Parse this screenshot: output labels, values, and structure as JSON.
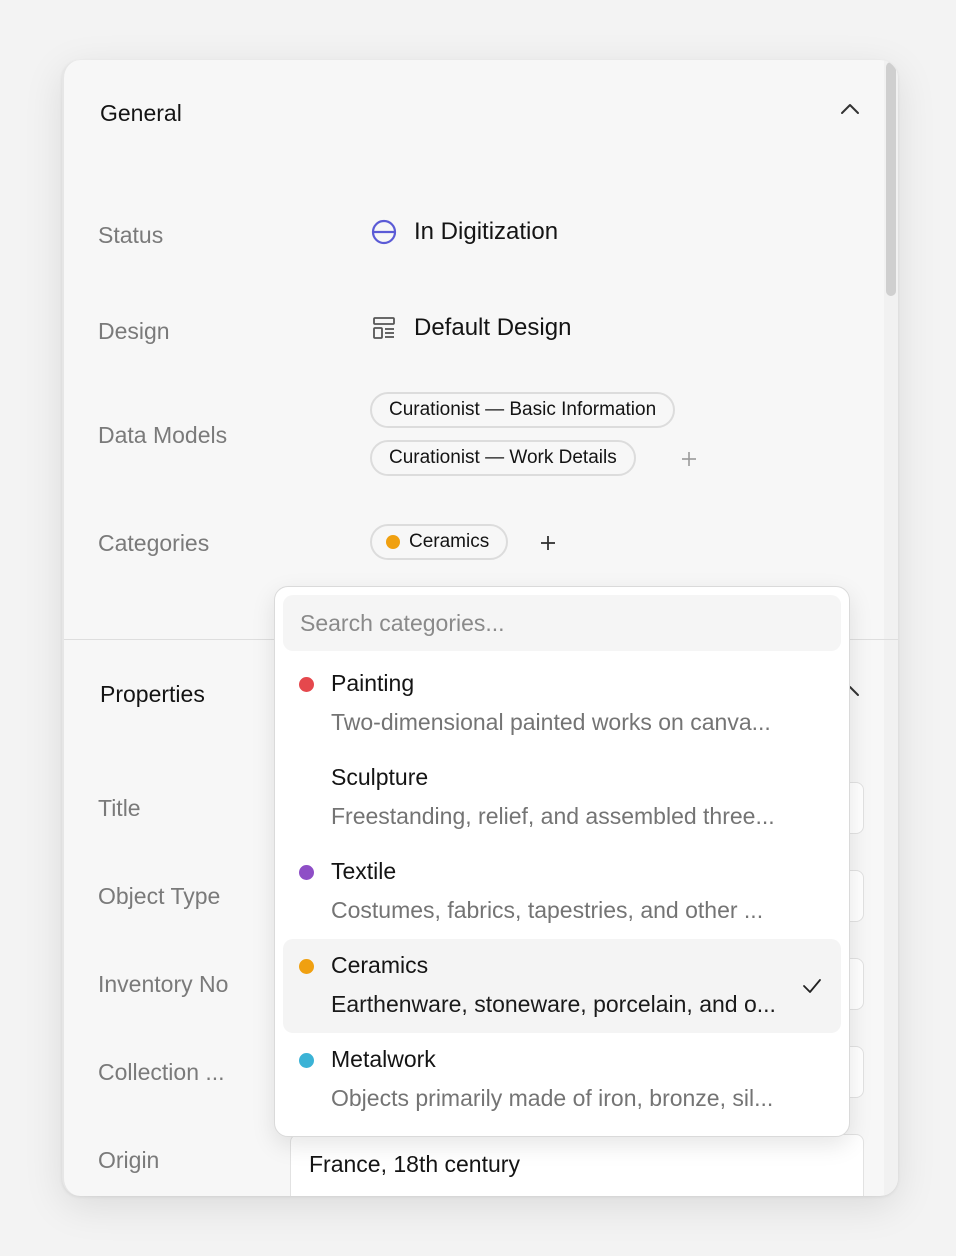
{
  "general": {
    "title": "General",
    "status": {
      "label": "Status",
      "value": "In Digitization",
      "icon": "half-circle-icon",
      "color": "#5b5bd6"
    },
    "design": {
      "label": "Design",
      "value": "Default Design",
      "icon": "layout-icon"
    },
    "data_models": {
      "label": "Data Models",
      "items": [
        "Curationist — Basic Information",
        "Curationist — Work Details"
      ]
    },
    "categories": {
      "label": "Categories",
      "items": [
        {
          "name": "Ceramics",
          "color": "#f0a010"
        }
      ]
    }
  },
  "properties": {
    "title": "Properties",
    "fields": [
      {
        "label": "Title",
        "value": ""
      },
      {
        "label": "Object Type",
        "value": ""
      },
      {
        "label": "Inventory No",
        "value": ""
      },
      {
        "label": "Collection ...",
        "value": ""
      },
      {
        "label": "Origin",
        "value": "France, 18th century"
      }
    ]
  },
  "dropdown": {
    "search_placeholder": "Search categories...",
    "options": [
      {
        "name": "Painting",
        "desc": "Two-dimensional painted works on canva...",
        "color": "#e5484d",
        "selected": false
      },
      {
        "name": "Sculpture",
        "desc": "Freestanding, relief, and assembled three...",
        "color": "",
        "selected": false
      },
      {
        "name": "Textile",
        "desc": "Costumes, fabrics, tapestries, and other ...",
        "color": "#8e4ec6",
        "selected": false
      },
      {
        "name": "Ceramics",
        "desc": "Earthenware, stoneware, porcelain, and o...",
        "color": "#f0a010",
        "selected": true
      },
      {
        "name": "Metalwork",
        "desc": "Objects primarily made of iron, bronze, sil...",
        "color": "#3bb3d6",
        "selected": false
      }
    ]
  }
}
